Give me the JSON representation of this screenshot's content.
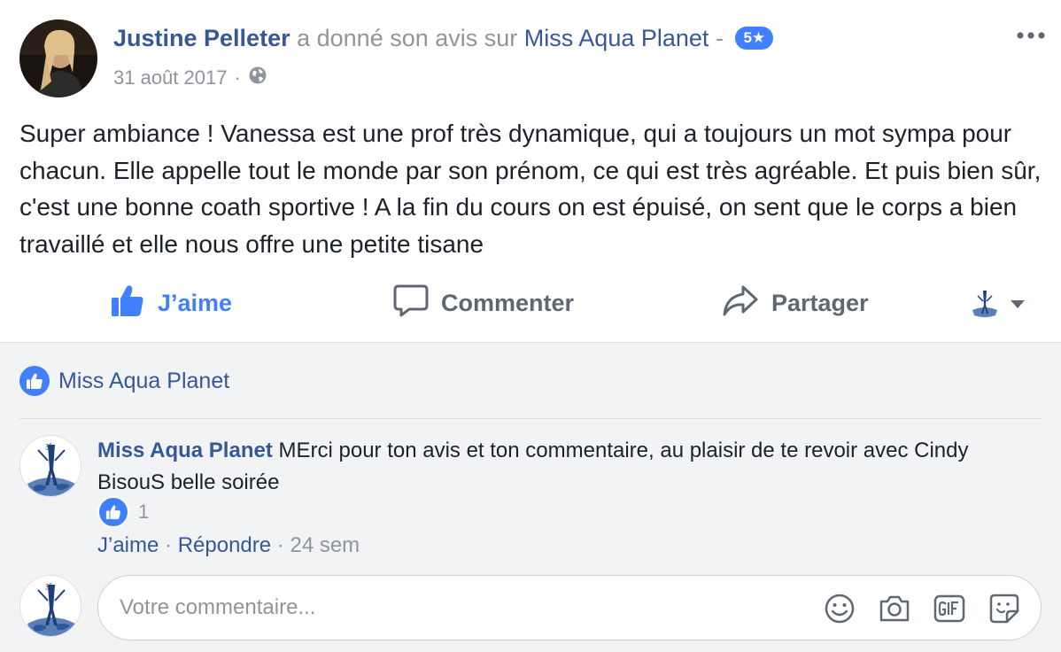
{
  "post": {
    "author": "Justine Pelleter",
    "action_text": "a donné son avis sur",
    "page_name": "Miss Aqua Planet",
    "separator": "-",
    "rating": "5",
    "date": "31 août 2017",
    "dot": "·",
    "privacy_icon": "globe-icon",
    "more_icon": "ellipsis-icon",
    "text": "Super ambiance ! Vanessa est une prof très dynamique, qui a toujours un mot sympa pour chacun. Elle appelle tout le monde par son prénom, ce qui est très agréable. Et puis bien sûr, c'est une bonne coath sportive ! A la fin du cours on est épuisé, on sent que le corps a bien travaillé et elle nous offre une petite tisane"
  },
  "actions": {
    "like": "J’aime",
    "comment": "Commenter",
    "share": "Partager"
  },
  "likes_summary": {
    "name": "Miss Aqua Planet"
  },
  "comment": {
    "author": "Miss Aqua Planet",
    "text": "MErci pour ton avis et ton commentaire, au plaisir de te revoir avec Cindy BisouS belle soirée",
    "reaction_count": "1",
    "like_label": "J’aime",
    "reply_label": "Répondre",
    "time": "24 sem",
    "dot": "·"
  },
  "compose": {
    "placeholder": "Votre commentaire..."
  },
  "colors": {
    "link": "#365899",
    "accent": "#4080ff",
    "muted": "#90949c",
    "comments_bg": "#f2f3f5"
  }
}
